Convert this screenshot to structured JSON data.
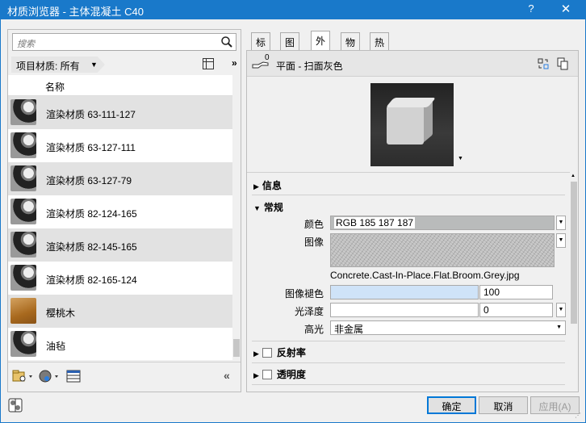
{
  "window": {
    "title": "材质浏览器 - 主体混凝土 C40",
    "help_label": "?",
    "close_label": "✕"
  },
  "left_panel": {
    "search_placeholder": "搜索",
    "library_crumb": "项目材质: 所有",
    "more_label": "»",
    "column_header": "名称",
    "materials": [
      {
        "name": "",
        "thumb": "blank"
      },
      {
        "name": "渲染材质 63-111-127",
        "thumb": "sphere"
      },
      {
        "name": "渲染材质 63-127-111",
        "thumb": "sphere"
      },
      {
        "name": "渲染材质 63-127-79",
        "thumb": "sphere"
      },
      {
        "name": "渲染材质 82-124-165",
        "thumb": "sphere"
      },
      {
        "name": "渲染材质 82-145-165",
        "thumb": "sphere"
      },
      {
        "name": "渲染材质 82-165-124",
        "thumb": "sphere"
      },
      {
        "name": "樱桃木",
        "thumb": "wood"
      },
      {
        "name": "油毡",
        "thumb": "sphere"
      },
      {
        "name": "",
        "thumb": "cube"
      }
    ],
    "collapse_label": "«"
  },
  "tabs": [
    "标识",
    "图形",
    "外观",
    "物理",
    "热度"
  ],
  "active_tab": "外观",
  "asset": {
    "users_count": "0",
    "name": "平面 - 扫面灰色"
  },
  "sections": {
    "info": "信息",
    "general": "常规",
    "reflectivity": "反射率",
    "transparency": "透明度"
  },
  "properties": {
    "color_label": "颜色",
    "color_value": "RGB 185 187 187",
    "image_label": "图像",
    "image_file": "Concrete.Cast-In-Place.Flat.Broom.Grey.jpg",
    "image_fade_label": "图像褪色",
    "image_fade_value": "100",
    "image_fade_fraction": 1.0,
    "glossiness_label": "光泽度",
    "glossiness_value": "0",
    "highlights_label": "高光",
    "highlights_value": "非金属"
  },
  "buttons": {
    "ok": "确定",
    "cancel": "取消",
    "apply": "应用(A)"
  },
  "colors": {
    "titlebar": "#1979ca",
    "selected_row": "#bcd6f1",
    "fade_fill": "#cfe3f8",
    "color_swatch": "#b9bbbb"
  }
}
